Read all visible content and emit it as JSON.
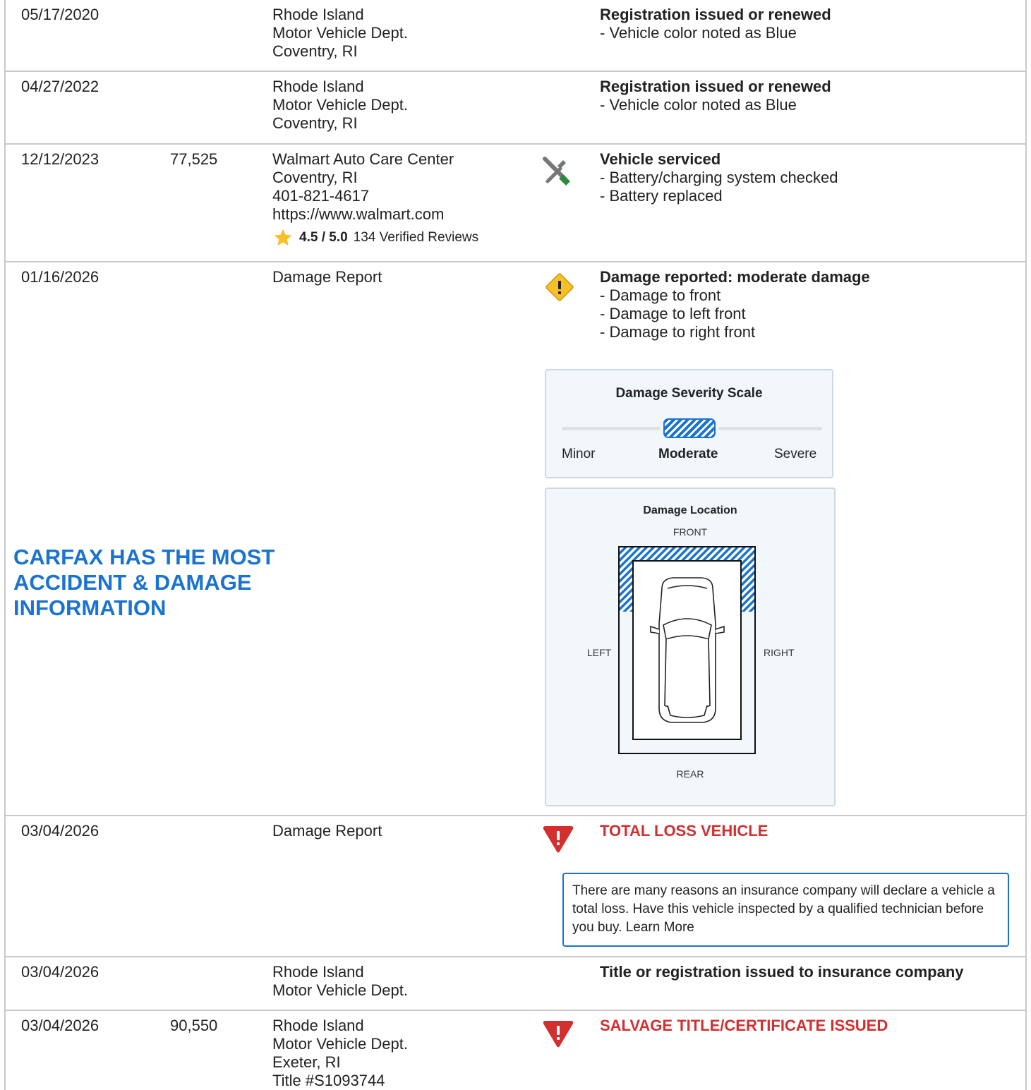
{
  "rows": [
    {
      "date": "05/17/2020",
      "odometer": "",
      "source": [
        "Rhode Island",
        "Motor Vehicle Dept.",
        "Coventry, RI"
      ],
      "heading": "Registration issued or renewed",
      "details": [
        "- Vehicle color noted as Blue"
      ]
    },
    {
      "date": "04/27/2022",
      "odometer": "",
      "source": [
        "Rhode Island",
        "Motor Vehicle Dept.",
        "Coventry, RI"
      ],
      "heading": "Registration issued or renewed",
      "details": [
        "- Vehicle color noted as Blue"
      ]
    },
    {
      "date": "12/12/2023",
      "odometer": "77,525",
      "source": [
        "Walmart Auto Care Center",
        "Coventry, RI",
        "401-821-4617",
        "https://www.walmart.com"
      ],
      "rating": {
        "score": "4.5 / 5.0",
        "reviews": "134 Verified Reviews"
      },
      "icon": "wrench-screwdriver-icon",
      "heading": "Vehicle serviced",
      "details": [
        "- Battery/charging system checked",
        "- Battery replaced"
      ]
    },
    {
      "date": "01/16/2026",
      "odometer": "",
      "source": [
        "Damage Report"
      ],
      "icon": "warning-diamond-icon",
      "heading": "Damage reported: moderate damage",
      "details": [
        "- Damage to front",
        "- Damage to left front",
        "- Damage to right front"
      ]
    },
    {
      "date": "03/04/2026",
      "odometer": "",
      "source": [
        "Damage Report"
      ],
      "icon": "alert-triangle-icon",
      "heading": "TOTAL LOSS VEHICLE"
    },
    {
      "date": "03/04/2026",
      "odometer": "",
      "source": [
        "Rhode Island",
        "Motor Vehicle Dept."
      ],
      "heading": "Title or registration issued to insurance company"
    },
    {
      "date": "03/04/2026",
      "odometer": "90,550",
      "source": [
        "Rhode Island",
        "Motor Vehicle Dept.",
        "Exeter, RI",
        "Title #S1093744"
      ],
      "icon": "alert-triangle-icon",
      "heading": "SALVAGE TITLE/CERTIFICATE ISSUED"
    }
  ],
  "promo": "CARFAX HAS THE MOST ACCIDENT & DAMAGE INFORMATION",
  "severity_scale": {
    "title": "Damage Severity Scale",
    "levels": [
      "Minor",
      "Moderate",
      "Severe"
    ],
    "selected": "Moderate"
  },
  "damage_location": {
    "title": "Damage Location",
    "front": "FRONT",
    "rear": "REAR",
    "left": "LEFT",
    "right": "RIGHT",
    "damaged_areas": [
      "front",
      "left front",
      "right front"
    ]
  },
  "total_loss_notice": "There are many reasons an insurance company will declare a vehicle a total loss. Have this vehicle inspected by a qualified technician before you buy. Learn More",
  "colors": {
    "accent_blue": "#1a73d0",
    "alert_red": "#d32f2f",
    "warning_yellow": "#f6c026",
    "border": "#c9c9c9"
  }
}
